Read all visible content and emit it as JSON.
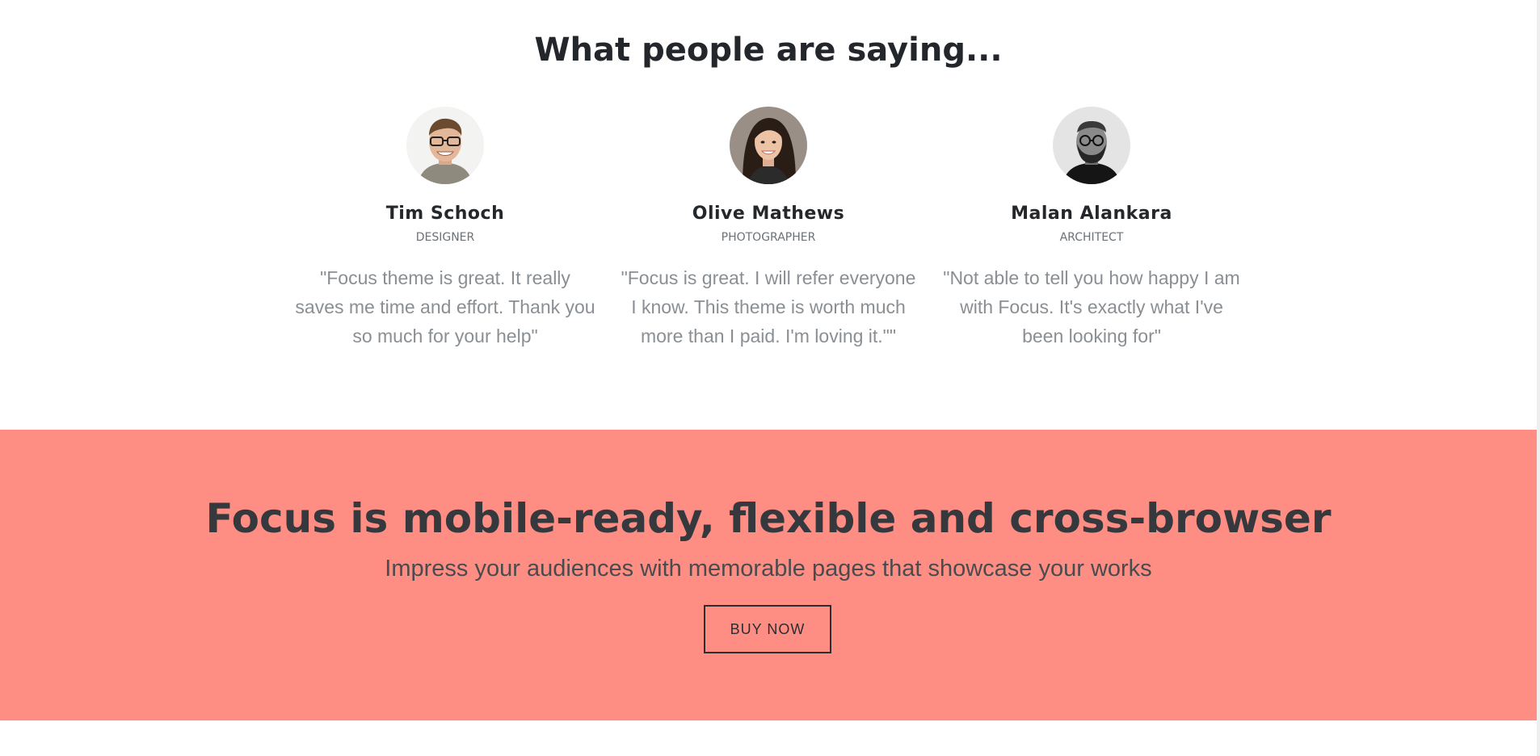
{
  "testimonials": {
    "title": "What people are saying...",
    "items": [
      {
        "name": "Tim Schoch",
        "role": "DESIGNER",
        "quote": "\"Focus theme is great. It really saves me time and effort. Thank you so much for your help\"",
        "avatar": "man-with-glasses-photo"
      },
      {
        "name": "Olive Mathews",
        "role": "PHOTOGRAPHER",
        "quote": "\"Focus is great. I will refer everyone I know. This theme is worth much more than I paid. I'm loving it.\"\"",
        "avatar": "woman-smiling-photo"
      },
      {
        "name": "Malan Alankara",
        "role": "ARCHITECT",
        "quote": "\"Not able to tell you how happy I am with Focus. It's exactly what I've been looking for\"",
        "avatar": "bearded-man-bw-photo"
      }
    ]
  },
  "cta": {
    "title": "Focus is mobile-ready, flexible and cross-browser",
    "subtitle": "Impress your audiences with memorable pages that showcase your works",
    "button_label": "BUY NOW",
    "background": "#fe8e83"
  }
}
